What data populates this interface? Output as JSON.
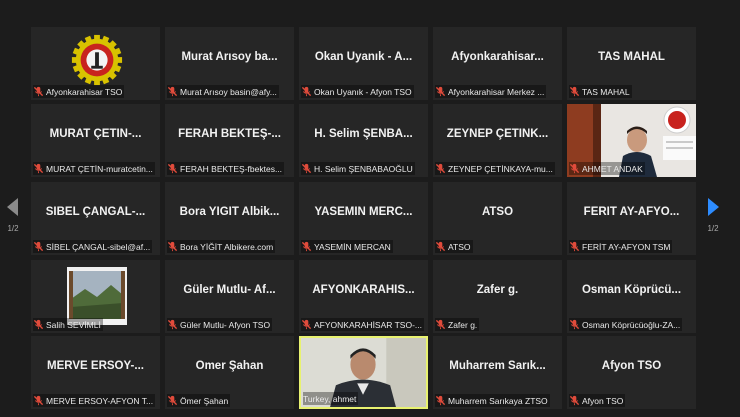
{
  "nav": {
    "page_left": "1/2",
    "page_right": "1/2"
  },
  "colors": {
    "tile_bg": "#262626",
    "active_border": "#e8f270",
    "mute_icon": "#e04b3b",
    "next_arrow": "#2d8cff"
  },
  "tiles": [
    {
      "type": "logo",
      "label": "Afyonkarahisar TSO"
    },
    {
      "type": "name",
      "big": "Murat Arısoy ba...",
      "label": "Murat Arısoy basin@afy..."
    },
    {
      "type": "name",
      "big": "Okan Uyanık - A...",
      "label": "Okan Uyanık - Afyon TSO"
    },
    {
      "type": "name",
      "big": "Afyonkarahisar...",
      "label": "Afyonkarahisar Merkez ..."
    },
    {
      "type": "name",
      "big": "TAS MAHAL",
      "label": "TAS MAHAL"
    },
    {
      "type": "name",
      "big": "MURAT ÇETİN-...",
      "label": "MURAT ÇETİN-muratcetin..."
    },
    {
      "type": "name",
      "big": "FERAH BEKTEŞ-...",
      "label": "FERAH BEKTEŞ-fbektes..."
    },
    {
      "type": "name",
      "big": "H. Selim ŞENBA...",
      "label": "H. Selim ŞENBABAOĞLU"
    },
    {
      "type": "name",
      "big": "ZEYNEP ÇETİNK...",
      "label": "ZEYNEP ÇETİNKAYA-mu..."
    },
    {
      "type": "video",
      "label": "AHMET ANDAK"
    },
    {
      "type": "name",
      "big": "SİBEL ÇANGAL-...",
      "label": "SİBEL ÇANGAL-sibel@af..."
    },
    {
      "type": "name",
      "big": "Bora YİĞİT Albik...",
      "label": "Bora YİĞİT Albikere.com"
    },
    {
      "type": "name",
      "big": "YASEMİN MERC...",
      "label": "YASEMİN MERCAN"
    },
    {
      "type": "name",
      "big": "ATSO",
      "label": "ATSO"
    },
    {
      "type": "name",
      "big": "FERİT AY-AFYO...",
      "label": "FERİT AY-AFYON TSM"
    },
    {
      "type": "photo",
      "label": "Salih SEVİMLİ"
    },
    {
      "type": "name",
      "big": "Güler Mutlu- Af...",
      "label": "Güler Mutlu- Afyon TSO"
    },
    {
      "type": "name",
      "big": "AFYONKARAHİS...",
      "label": "AFYONKARAHİSAR TSO-..."
    },
    {
      "type": "name",
      "big": "Zafer g.",
      "label": "Zafer g."
    },
    {
      "type": "name",
      "big": "Osman Köprücü...",
      "label": "Osman Köprücüoğlu-ZA..."
    },
    {
      "type": "name",
      "big": "MERVE ERSOY-...",
      "label": "MERVE ERSOY-AFYON T..."
    },
    {
      "type": "name",
      "big": "Ömer Şahan",
      "label": "Ömer Şahan"
    },
    {
      "type": "speaker",
      "label": "Turkey, ahmet"
    },
    {
      "type": "name",
      "big": "Muharrem Sarık...",
      "label": "Muharrem Sarıkaya ZTSO"
    },
    {
      "type": "name",
      "big": "Afyon TSO",
      "label": "Afyon TSO"
    }
  ]
}
